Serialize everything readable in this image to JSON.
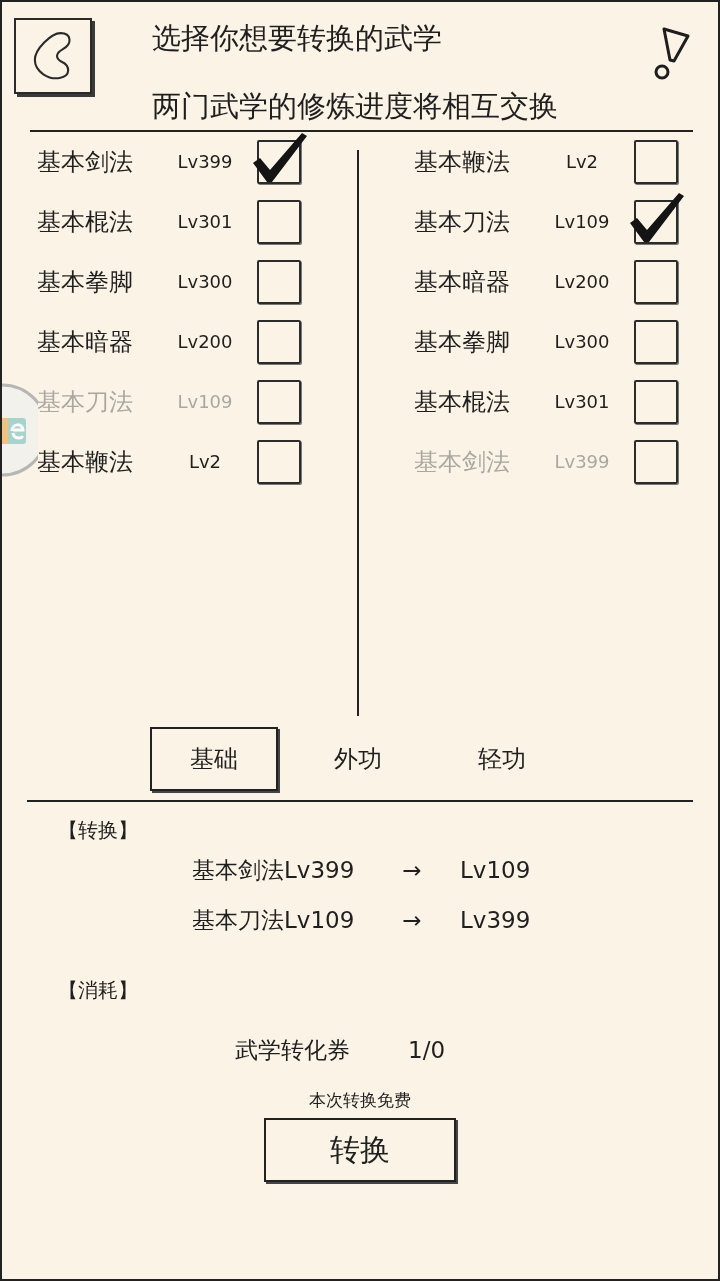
{
  "header": {
    "title": "选择你想要转换的武学",
    "subtitle": "两门武学的修炼进度将相互交换"
  },
  "skills_left": [
    {
      "name": "基本剑法",
      "lv": "Lv399",
      "checked": true,
      "disabled": false
    },
    {
      "name": "基本棍法",
      "lv": "Lv301",
      "checked": false,
      "disabled": false
    },
    {
      "name": "基本拳脚",
      "lv": "Lv300",
      "checked": false,
      "disabled": false
    },
    {
      "name": "基本暗器",
      "lv": "Lv200",
      "checked": false,
      "disabled": false
    },
    {
      "name": "基本刀法",
      "lv": "Lv109",
      "checked": false,
      "disabled": true
    },
    {
      "name": "基本鞭法",
      "lv": "Lv2",
      "checked": false,
      "disabled": false
    }
  ],
  "skills_right": [
    {
      "name": "基本鞭法",
      "lv": "Lv2",
      "checked": false,
      "disabled": false
    },
    {
      "name": "基本刀法",
      "lv": "Lv109",
      "checked": true,
      "disabled": false
    },
    {
      "name": "基本暗器",
      "lv": "Lv200",
      "checked": false,
      "disabled": false
    },
    {
      "name": "基本拳脚",
      "lv": "Lv300",
      "checked": false,
      "disabled": false
    },
    {
      "name": "基本棍法",
      "lv": "Lv301",
      "checked": false,
      "disabled": false
    },
    {
      "name": "基本剑法",
      "lv": "Lv399",
      "checked": false,
      "disabled": true
    }
  ],
  "category_tabs": [
    {
      "label": "基础",
      "selected": true
    },
    {
      "label": "外功",
      "selected": false
    },
    {
      "label": "轻功",
      "selected": false
    }
  ],
  "conversion": {
    "heading": "【转换】",
    "rows": [
      {
        "from": "基本剑法Lv399",
        "arrow": "→",
        "to": "Lv109"
      },
      {
        "from": "基本刀法Lv109",
        "arrow": "→",
        "to": "Lv399"
      }
    ]
  },
  "cost": {
    "heading": "【消耗】",
    "item": "武学转化券",
    "count": "1/0",
    "note": "本次转换免费"
  },
  "convert_button": {
    "label": "转换"
  }
}
